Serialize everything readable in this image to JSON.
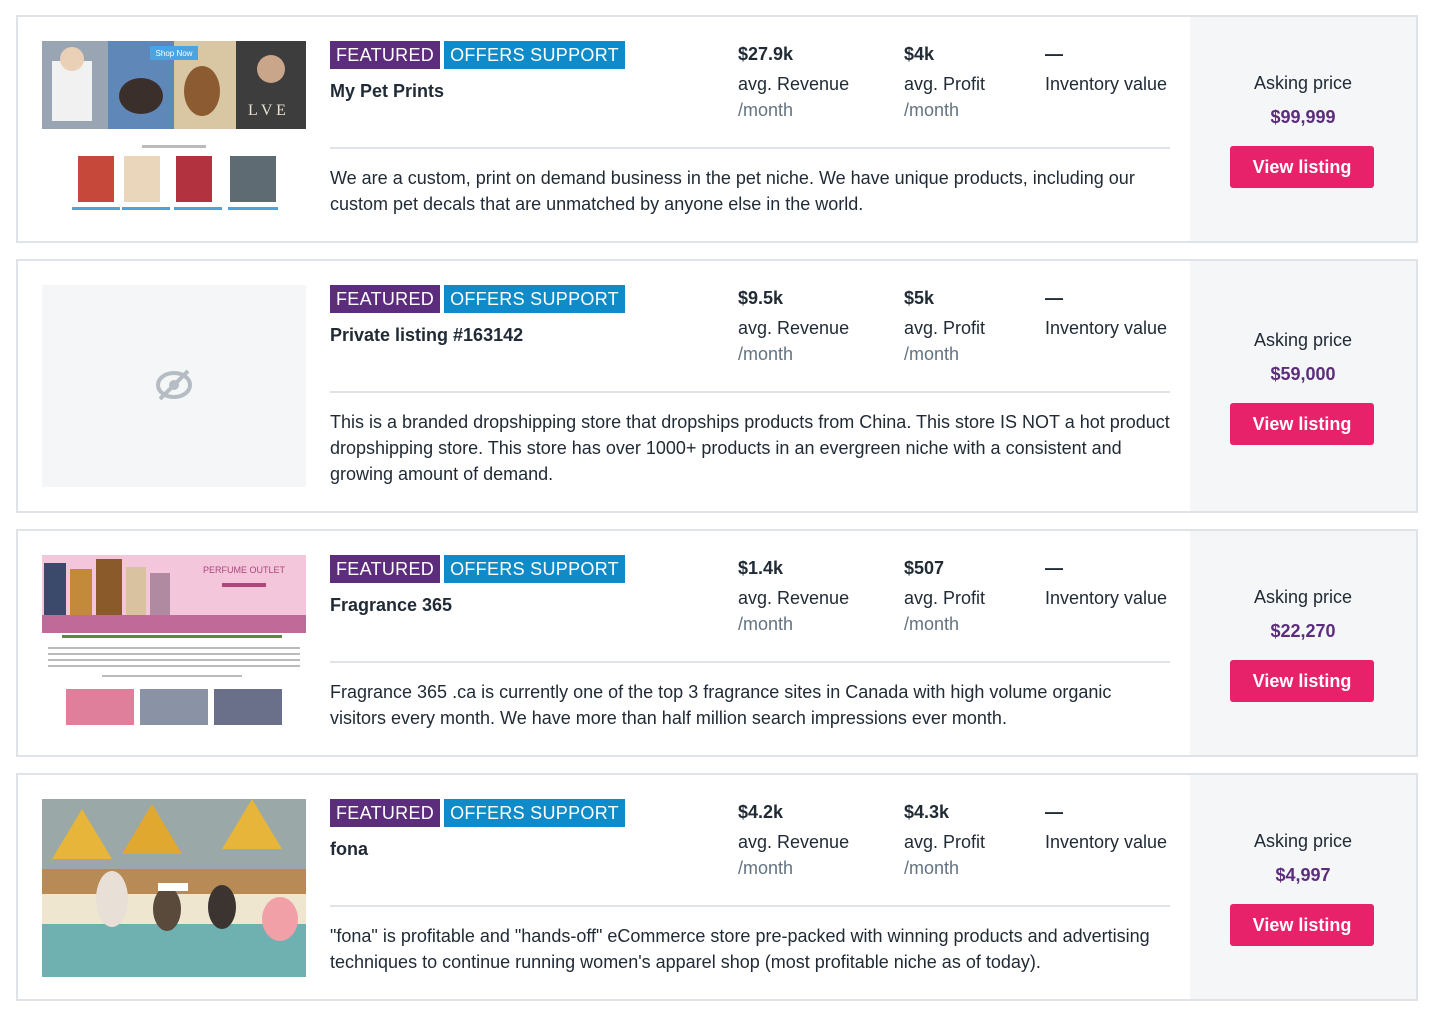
{
  "listings": [
    {
      "badges": {
        "featured": "FEATURED",
        "support": "OFFERS SUPPORT"
      },
      "title": "My Pet Prints",
      "revenue": {
        "value": "$27.9k",
        "label": "avg. Revenue",
        "period": "/month"
      },
      "profit": {
        "value": "$4k",
        "label": "avg. Profit",
        "period": "/month"
      },
      "inventory": {
        "value": "—",
        "label": "Inventory value"
      },
      "description": "We are a custom, print on demand business in the pet niche. We have unique products, including our custom pet decals that are unmatched by anyone else in the world.",
      "asking_label": "Asking price",
      "asking_price": "$99,999",
      "button": "View listing",
      "thumb_text": "Shop Now"
    },
    {
      "badges": {
        "featured": "FEATURED",
        "support": "OFFERS SUPPORT"
      },
      "title": "Private listing #163142",
      "revenue": {
        "value": "$9.5k",
        "label": "avg. Revenue",
        "period": "/month"
      },
      "profit": {
        "value": "$5k",
        "label": "avg. Profit",
        "period": "/month"
      },
      "inventory": {
        "value": "—",
        "label": "Inventory value"
      },
      "description": "This is a branded dropshipping store that dropships products from China. This store IS NOT a hot product dropshipping store. This store has over 1000+ products in an evergreen niche with a consistent and growing amount of demand.",
      "asking_label": "Asking price",
      "asking_price": "$59,000",
      "button": "View listing"
    },
    {
      "badges": {
        "featured": "FEATURED",
        "support": "OFFERS SUPPORT"
      },
      "title": "Fragrance 365",
      "revenue": {
        "value": "$1.4k",
        "label": "avg. Revenue",
        "period": "/month"
      },
      "profit": {
        "value": "$507",
        "label": "avg. Profit",
        "period": "/month"
      },
      "inventory": {
        "value": "—",
        "label": "Inventory value"
      },
      "description": "Fragrance 365 .ca is currently one of the top 3 fragrance sites in Canada with high volume organic visitors every month. We have more than half million search impressions ever month.",
      "asking_label": "Asking price",
      "asking_price": "$22,270",
      "button": "View listing",
      "thumb_text": "PERFUME OUTLET"
    },
    {
      "badges": {
        "featured": "FEATURED",
        "support": "OFFERS SUPPORT"
      },
      "title": "fona",
      "revenue": {
        "value": "$4.2k",
        "label": "avg. Revenue",
        "period": "/month"
      },
      "profit": {
        "value": "$4.3k",
        "label": "avg. Profit",
        "period": "/month"
      },
      "inventory": {
        "value": "—",
        "label": "Inventory value"
      },
      "description": "\"fona\" is profitable and \"hands-off\" eCommerce store pre-packed with winning products and advertising techniques to continue running women's apparel shop (most profitable niche as of today).",
      "asking_label": "Asking price",
      "asking_price": "$4,997",
      "button": "View listing"
    }
  ],
  "colors": {
    "featured": "#5c2c7d",
    "support": "#0e8bc8",
    "button": "#e8216b",
    "price": "#5c2c7d",
    "price_panel": "#f4f6f8",
    "border": "#dfe3e8"
  },
  "icons": {
    "private_thumbnail": "eye-slash-icon"
  }
}
